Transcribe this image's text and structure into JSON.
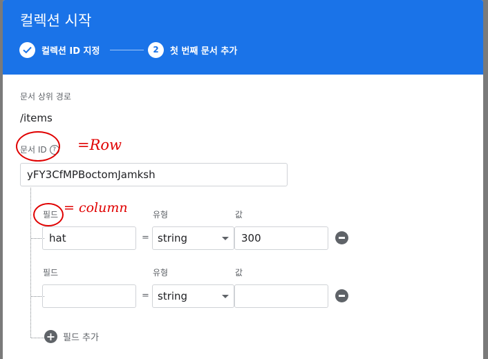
{
  "dialog": {
    "title": "컬렉션 시작",
    "steps": [
      {
        "label": "컬렉션 ID 지정",
        "state": "done",
        "icon": "check-icon"
      },
      {
        "number": "2",
        "label": "첫 번째 문서 추가",
        "state": "active"
      }
    ]
  },
  "document": {
    "parent_path_label": "문서 상위 경로",
    "parent_path": "/items",
    "id_label": "문서 ID",
    "id_help_icon": "help-icon",
    "id_value": "yFY3CfMPBoctomJamksh"
  },
  "fields": [
    {
      "field_label": "필드",
      "type_label": "유형",
      "value_label": "값",
      "name": "hat",
      "type": "string",
      "value": "300"
    },
    {
      "field_label": "필드",
      "type_label": "유형",
      "value_label": "값",
      "name": "",
      "type": "string",
      "value": ""
    }
  ],
  "add_field_label": "필드 추가",
  "annotations": {
    "row": "=Row",
    "column": "= column"
  },
  "colors": {
    "header": "#1a73e8",
    "annotation": "#e00000"
  }
}
